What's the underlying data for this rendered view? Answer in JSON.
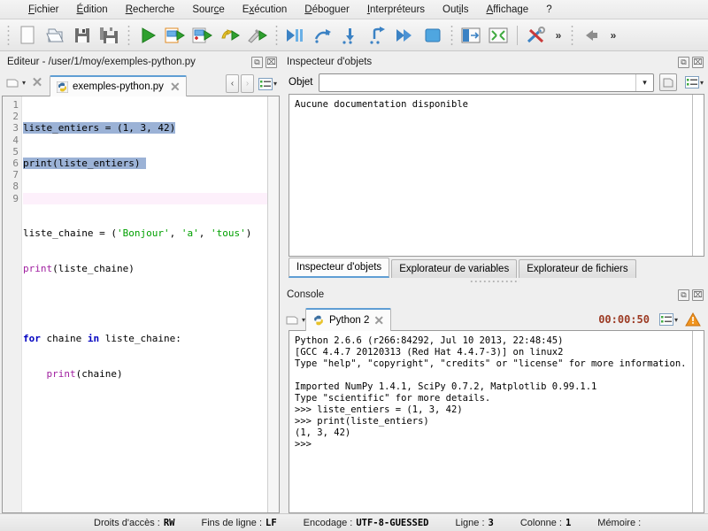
{
  "menubar": {
    "items": [
      {
        "label": "Fichier",
        "mnemonic": "F"
      },
      {
        "label": "Édition",
        "mnemonic": "É"
      },
      {
        "label": "Recherche",
        "mnemonic": "R"
      },
      {
        "label": "Source",
        "mnemonic": "c"
      },
      {
        "label": "Exécution",
        "mnemonic": "x"
      },
      {
        "label": "Déboguer",
        "mnemonic": "D"
      },
      {
        "label": "Interpréteurs",
        "mnemonic": "I"
      },
      {
        "label": "Outils",
        "mnemonic": "i"
      },
      {
        "label": "Affichage",
        "mnemonic": "A"
      },
      {
        "label": "?",
        "mnemonic": ""
      }
    ]
  },
  "toolbar": {
    "buttons": [
      {
        "name": "new-file-icon",
        "tooltip": "Nouveau fichier"
      },
      {
        "name": "open-file-icon",
        "tooltip": "Ouvrir"
      },
      {
        "name": "save-file-icon",
        "tooltip": "Enregistrer"
      },
      {
        "name": "save-all-icon",
        "tooltip": "Tout enregistrer"
      },
      {
        "name": "run-file-icon",
        "tooltip": "Exécuter"
      },
      {
        "name": "run-cell-icon",
        "tooltip": "Exécuter la cellule"
      },
      {
        "name": "run-cell-advance-icon",
        "tooltip": "Exécuter la cellule et avancer"
      },
      {
        "name": "run-selection-icon",
        "tooltip": "Exécuter la sélection"
      },
      {
        "name": "configure-run-icon",
        "tooltip": "Configurer"
      },
      {
        "name": "debug-file-icon",
        "tooltip": "Déboguer"
      },
      {
        "name": "step-over-icon",
        "tooltip": "Pas à pas"
      },
      {
        "name": "step-into-icon",
        "tooltip": "Entrer"
      },
      {
        "name": "step-return-icon",
        "tooltip": "Sortir"
      },
      {
        "name": "continue-icon",
        "tooltip": "Continuer"
      },
      {
        "name": "stop-debug-icon",
        "tooltip": "Arrêter"
      },
      {
        "name": "maximize-pane-icon",
        "tooltip": "Maximiser le panneau"
      },
      {
        "name": "fullscreen-icon",
        "tooltip": "Plein écran"
      },
      {
        "name": "preferences-icon",
        "tooltip": "Préférences"
      },
      {
        "name": "overflow-chevron-icon",
        "tooltip": "Plus"
      },
      {
        "name": "back-arrow-icon",
        "tooltip": "Précédent"
      },
      {
        "name": "forward-chevron-icon",
        "tooltip": "Suivant"
      }
    ]
  },
  "editor_dock": {
    "title": "Éditeur - /user/1/moy/exemples-python.py",
    "undock_label": "⧉",
    "close_label": "⌧",
    "tab": {
      "filename": "exemples-python.py",
      "close_label": "✕"
    },
    "close_all_label": "✕",
    "prev_arrow": "‹",
    "next_arrow": "›"
  },
  "code": {
    "line_numbers": [
      "1",
      "2",
      "3",
      "4",
      "5",
      "6",
      "7",
      "8",
      "9"
    ],
    "lines": [
      "liste_entiers = (1, 3, 42)",
      "print(liste_entiers)",
      "",
      "liste_chaine = ('Bonjour', 'a', 'tous')",
      "print(liste_chaine)",
      "",
      "for chaine in liste_chaine:",
      "    print(chaine)",
      ""
    ],
    "selected_lines": [
      1,
      2
    ],
    "current_line": 3
  },
  "inspector_dock": {
    "title": "Inspecteur d'objets",
    "undock_label": "⧉",
    "close_label": "⌧",
    "object_label": "Objet",
    "object_value": "",
    "object_placeholder": "",
    "doc_text": "Aucune documentation disponible",
    "tabs": [
      {
        "label": "Inspecteur d'objets",
        "active": true
      },
      {
        "label": "Explorateur de variables",
        "active": false
      },
      {
        "label": "Explorateur de fichiers",
        "active": false
      }
    ]
  },
  "console_dock": {
    "title": "Console",
    "undock_label": "⧉",
    "close_label": "⌧",
    "tab": {
      "label": "Python 2",
      "close_label": "✕"
    },
    "timer": "00:00:50",
    "options_label": "▾",
    "warning_label": "!",
    "output": "Python 2.6.6 (r266:84292, Jul 10 2013, 22:48:45)\n[GCC 4.4.7 20120313 (Red Hat 4.4.7-3)] on linux2\nType \"help\", \"copyright\", \"credits\" or \"license\" for more information.\n\nImported NumPy 1.4.1, SciPy 0.7.2, Matplotlib 0.99.1.1\nType \"scientific\" for more details.\n>>> liste_entiers = (1, 3, 42)\n>>> print(liste_entiers)\n(1, 3, 42)\n>>>"
  },
  "statusbar": {
    "items": [
      {
        "key": "Droits d'accès :",
        "value": "RW"
      },
      {
        "key": "Fins de ligne :",
        "value": "LF"
      },
      {
        "key": "Encodage :",
        "value": "UTF-8-GUESSED"
      },
      {
        "key": "Ligne :",
        "value": "3"
      },
      {
        "key": "Colonne :",
        "value": "1"
      },
      {
        "key": "Mémoire :",
        "value": ""
      }
    ]
  },
  "colors": {
    "accent": "#5f9ed4",
    "selection": "#9bb2d6",
    "current_line": "#fdf0fb",
    "timer": "#9c3a23",
    "keyword": "#0000c0",
    "builtin": "#a020a0",
    "string": "#00a000"
  }
}
